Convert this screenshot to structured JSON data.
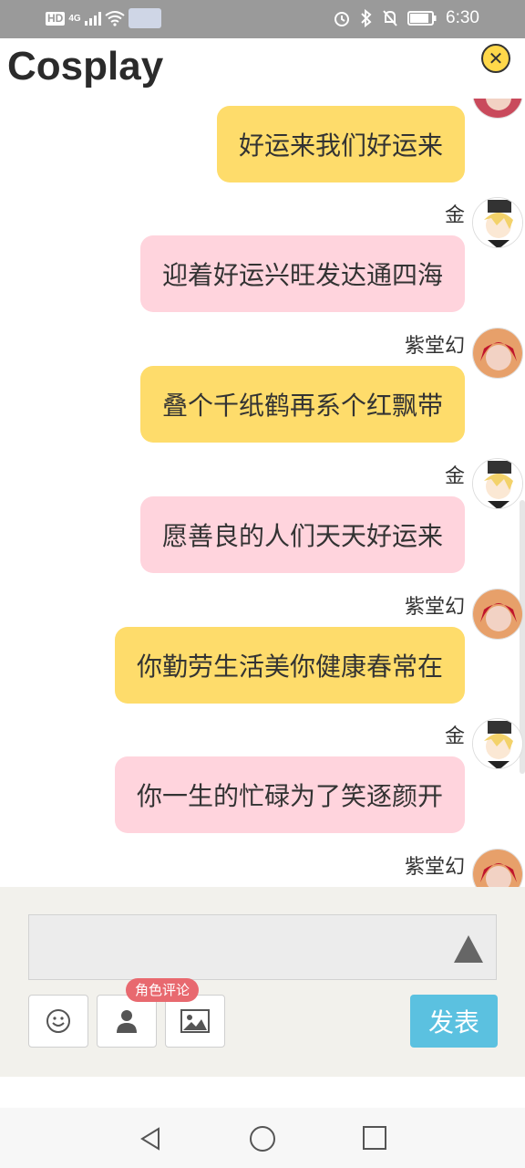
{
  "status_bar": {
    "hd": "HD",
    "network": "4G",
    "time": "6:30"
  },
  "header": {
    "title": "Cosplay",
    "close_icon": "close-circle-icon"
  },
  "messages": [
    {
      "sender": "",
      "text": "好运来我们好运来",
      "color": "yellow",
      "avatar": "red-hair"
    },
    {
      "sender": "金",
      "text": "迎着好运兴旺发达通四海",
      "color": "pink",
      "avatar": "blonde"
    },
    {
      "sender": "紫堂幻",
      "text": "叠个千纸鹤再系个红飘带",
      "color": "yellow",
      "avatar": "red-hair"
    },
    {
      "sender": "金",
      "text": "愿善良的人们天天好运来",
      "color": "pink",
      "avatar": "blonde"
    },
    {
      "sender": "紫堂幻",
      "text": "你勤劳生活美你健康春常在",
      "color": "yellow",
      "avatar": "red-hair"
    },
    {
      "sender": "金",
      "text": "你一生的忙碌为了笑逐颜开",
      "color": "pink",
      "avatar": "blonde"
    },
    {
      "sender": "紫堂幻",
      "text": "",
      "color": "yellow",
      "avatar": "red-hair"
    }
  ],
  "composer": {
    "input_value": "",
    "badge": "角色评论",
    "post_label": "发表",
    "tools": [
      "smiley-icon",
      "person-icon",
      "image-icon"
    ]
  },
  "colors": {
    "yellow_bubble": "#fedc6b",
    "pink_bubble": "#ffd4dd",
    "post_button": "#5bc1e0",
    "badge": "#e8696f"
  }
}
